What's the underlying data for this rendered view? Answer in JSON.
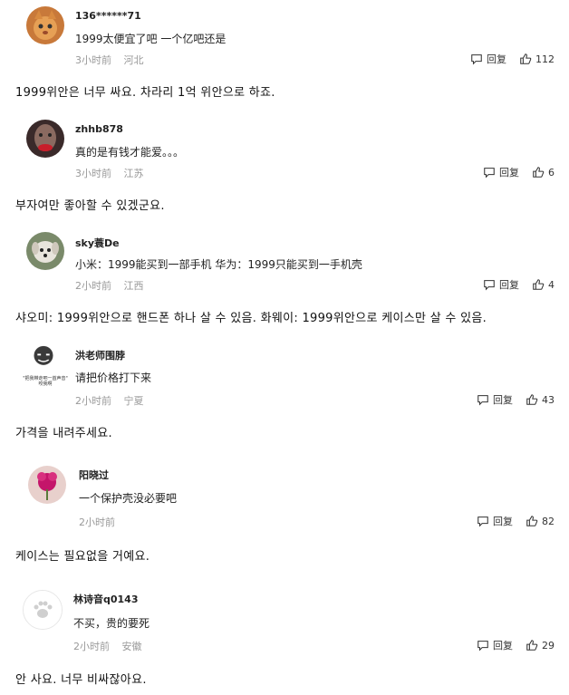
{
  "comments": [
    {
      "user": "136******71",
      "text": "1999太便宜了吧 一个亿吧还是",
      "time": "3小时前",
      "location": "河北",
      "reply": "回复",
      "likes": "112",
      "translation": "1999위안은 너무 싸요. 차라리 1억 위안으로 하죠.",
      "avatar_icon": "cat-avatar-icon"
    },
    {
      "user": "zhhb878",
      "text": "真的是有钱才能爱。。。",
      "time": "3小时前",
      "location": "江苏",
      "reply": "回复",
      "likes": "6",
      "translation": "부자여만 좋아할 수 있겠군요.",
      "avatar_icon": "portrait-avatar-icon"
    },
    {
      "user": "sky蓑De",
      "text": "小米：1999能买到一部手机 华为：1999只能买到一手机壳",
      "time": "2小时前",
      "location": "江西",
      "reply": "回复",
      "likes": "4",
      "translation": "샤오미: 1999위안으로 핸드폰 하나 살 수 있음. 화웨이: 1999위안으로 케이스만 살 수 있음.",
      "avatar_icon": "dog-avatar-icon"
    },
    {
      "user": "洪老师围脖",
      "text": "请把价格打下来",
      "time": "2小时前",
      "location": "宁夏",
      "reply": "回复",
      "likes": "43",
      "translation": "가격을 내려주세요.",
      "avatar_icon": "meme-avatar-icon",
      "avatar_caption": "\"把我带走吧一首声音\" 咬我啊"
    },
    {
      "user": "阳晓过",
      "text": "一个保护壳没必要吧",
      "time": "2小时前",
      "location": "",
      "reply": "回复",
      "likes": "82",
      "translation": "케이스는 필요없을 거예요.",
      "avatar_icon": "flower-avatar-icon"
    },
    {
      "user": "林诗音q0143",
      "text": "不买，贵的要死",
      "time": "2小时前",
      "location": "安徽",
      "reply": "回复",
      "likes": "29",
      "translation": "안 사요. 너무 비싸잖아요.",
      "avatar_icon": "paw-avatar-icon"
    }
  ],
  "colors": {
    "meta": "#999999",
    "text": "#222222",
    "background": "#ffffff"
  }
}
